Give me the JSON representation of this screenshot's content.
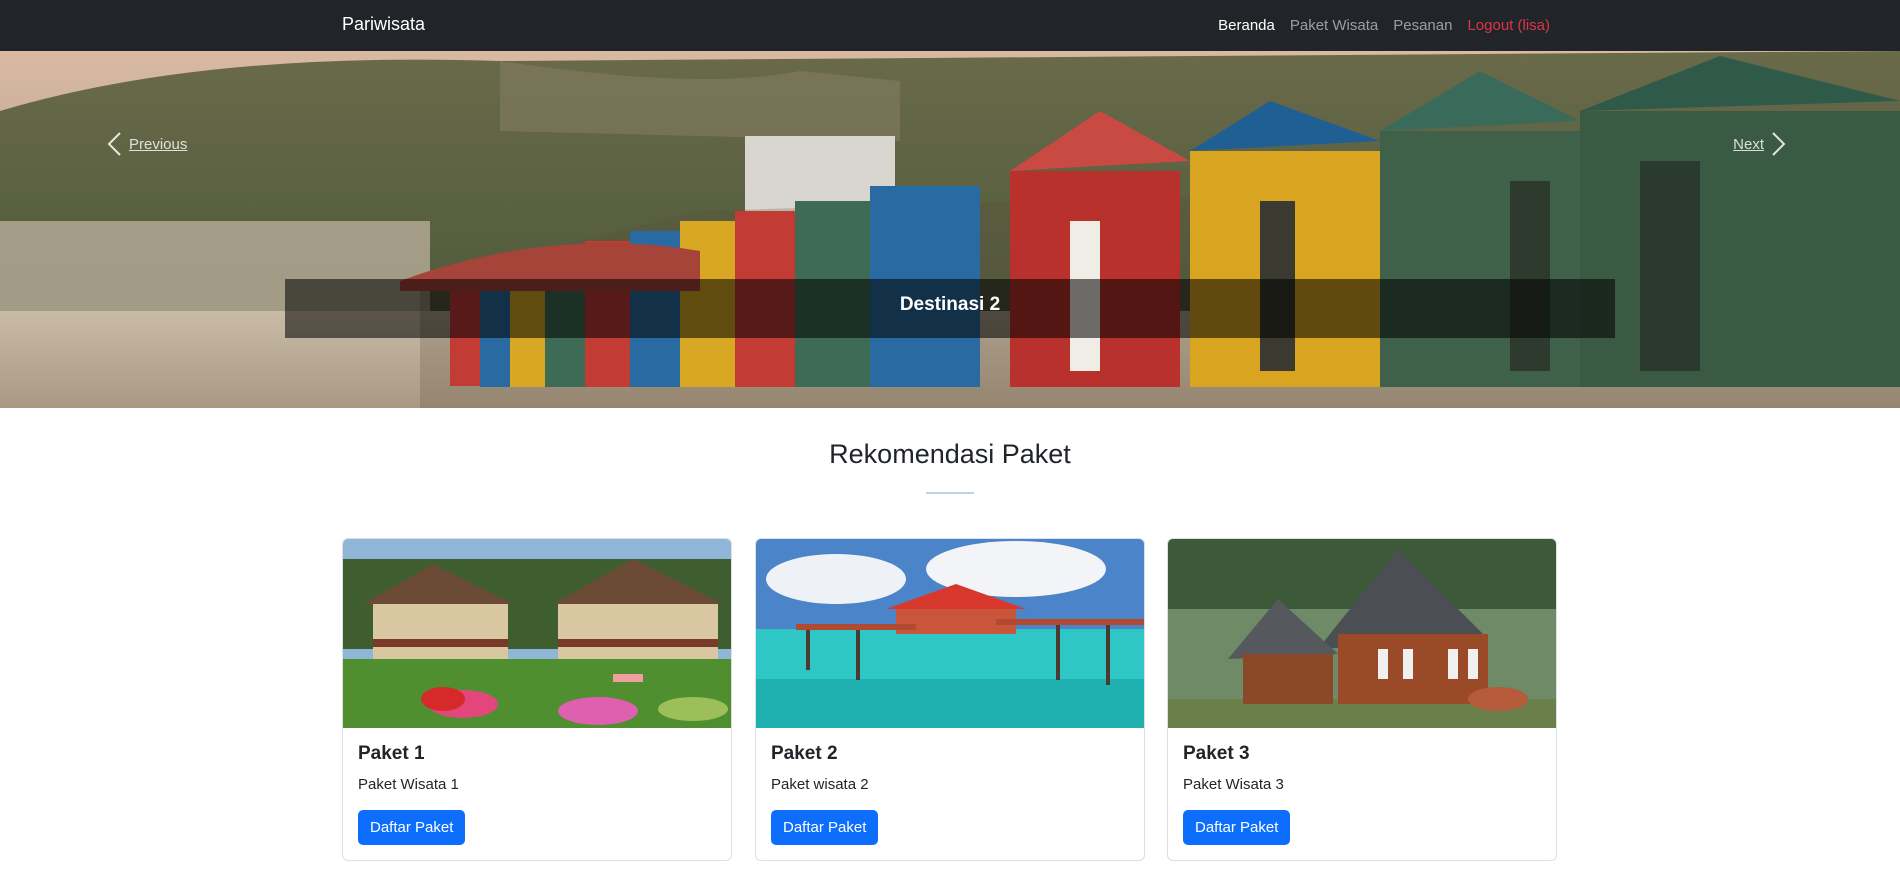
{
  "navbar": {
    "brand": "Pariwisata",
    "links": [
      {
        "label": "Beranda"
      },
      {
        "label": "Paket Wisata"
      },
      {
        "label": "Pesanan"
      },
      {
        "label": "Logout (lisa)"
      }
    ]
  },
  "carousel": {
    "prev_label": "Previous",
    "next_label": "Next",
    "caption": "Destinasi 2"
  },
  "section": {
    "title": "Rekomendasi Paket"
  },
  "cards": [
    {
      "title": "Paket 1",
      "text": "Paket Wisata 1",
      "button": "Daftar Paket"
    },
    {
      "title": "Paket 2",
      "text": "Paket wisata 2",
      "button": "Daftar Paket"
    },
    {
      "title": "Paket 3",
      "text": "Paket Wisata 3",
      "button": "Daftar Paket"
    }
  ],
  "colors": {
    "navbar_bg": "#212529",
    "accent": "#0d6efd",
    "logout": "#dc3545"
  }
}
